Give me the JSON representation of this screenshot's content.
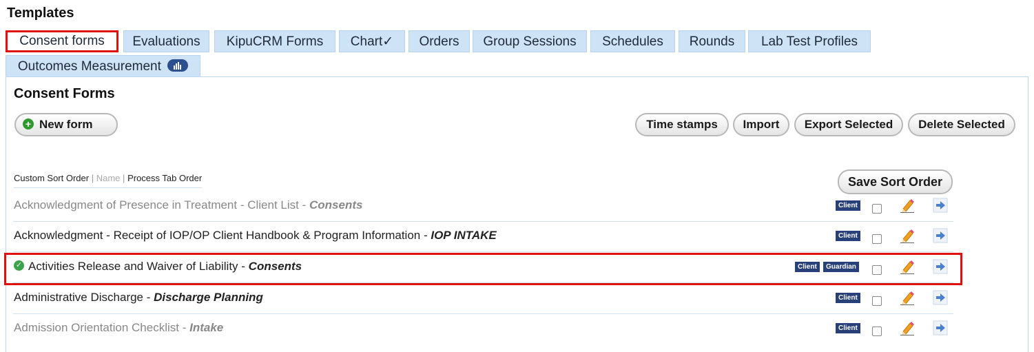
{
  "page_title": "Templates",
  "tabs": [
    {
      "label": "Consent forms",
      "active": true
    },
    {
      "label": "Evaluations"
    },
    {
      "label": "KipuCRM Forms"
    },
    {
      "label": "Chart✓"
    },
    {
      "label": "Orders"
    },
    {
      "label": "Group Sessions"
    },
    {
      "label": "Schedules"
    },
    {
      "label": "Rounds"
    },
    {
      "label": "Lab Test Profiles"
    },
    {
      "label": "Outcomes Measurement",
      "icon": "bar-chart-icon"
    }
  ],
  "section_title": "Consent Forms",
  "buttons": {
    "new_form": "New form",
    "time_stamps": "Time stamps",
    "import": "Import",
    "export_selected": "Export Selected",
    "delete_selected": "Delete Selected",
    "save_sort_order": "Save Sort Order"
  },
  "sort_links": {
    "custom": "Custom Sort Order",
    "name": "Name",
    "process_tab": "Process Tab Order",
    "separator": "|"
  },
  "rows": [
    {
      "name": "Acknowledgment of Presence in Treatment - Client List",
      "separator": " - ",
      "category": "Consents",
      "badges": [
        "Client"
      ],
      "muted": true,
      "checked_icon": false,
      "selected": false
    },
    {
      "name": "Acknowledgment - Receipt of IOP/OP Client Handbook & Program Information",
      "separator": " - ",
      "category": "IOP INTAKE",
      "badges": [
        "Client"
      ],
      "muted": false,
      "checked_icon": false,
      "selected": false
    },
    {
      "name": "Activities Release and Waiver of Liability",
      "separator": " - ",
      "category": "Consents",
      "badges": [
        "Client",
        "Guardian"
      ],
      "muted": false,
      "checked_icon": true,
      "selected": false
    },
    {
      "name": "Administrative Discharge",
      "separator": " - ",
      "category": "Discharge Planning",
      "badges": [
        "Client"
      ],
      "muted": false,
      "checked_icon": false,
      "selected": false
    },
    {
      "name": "Admission Orientation Checklist",
      "separator": " - ",
      "category": "Intake",
      "badges": [
        "Client"
      ],
      "muted": true,
      "checked_icon": false,
      "selected": false
    }
  ],
  "colors": {
    "tab_bg": "#cfe3f7",
    "highlight": "#e01010",
    "badge": "#27407a",
    "check_green": "#3aa34a"
  }
}
